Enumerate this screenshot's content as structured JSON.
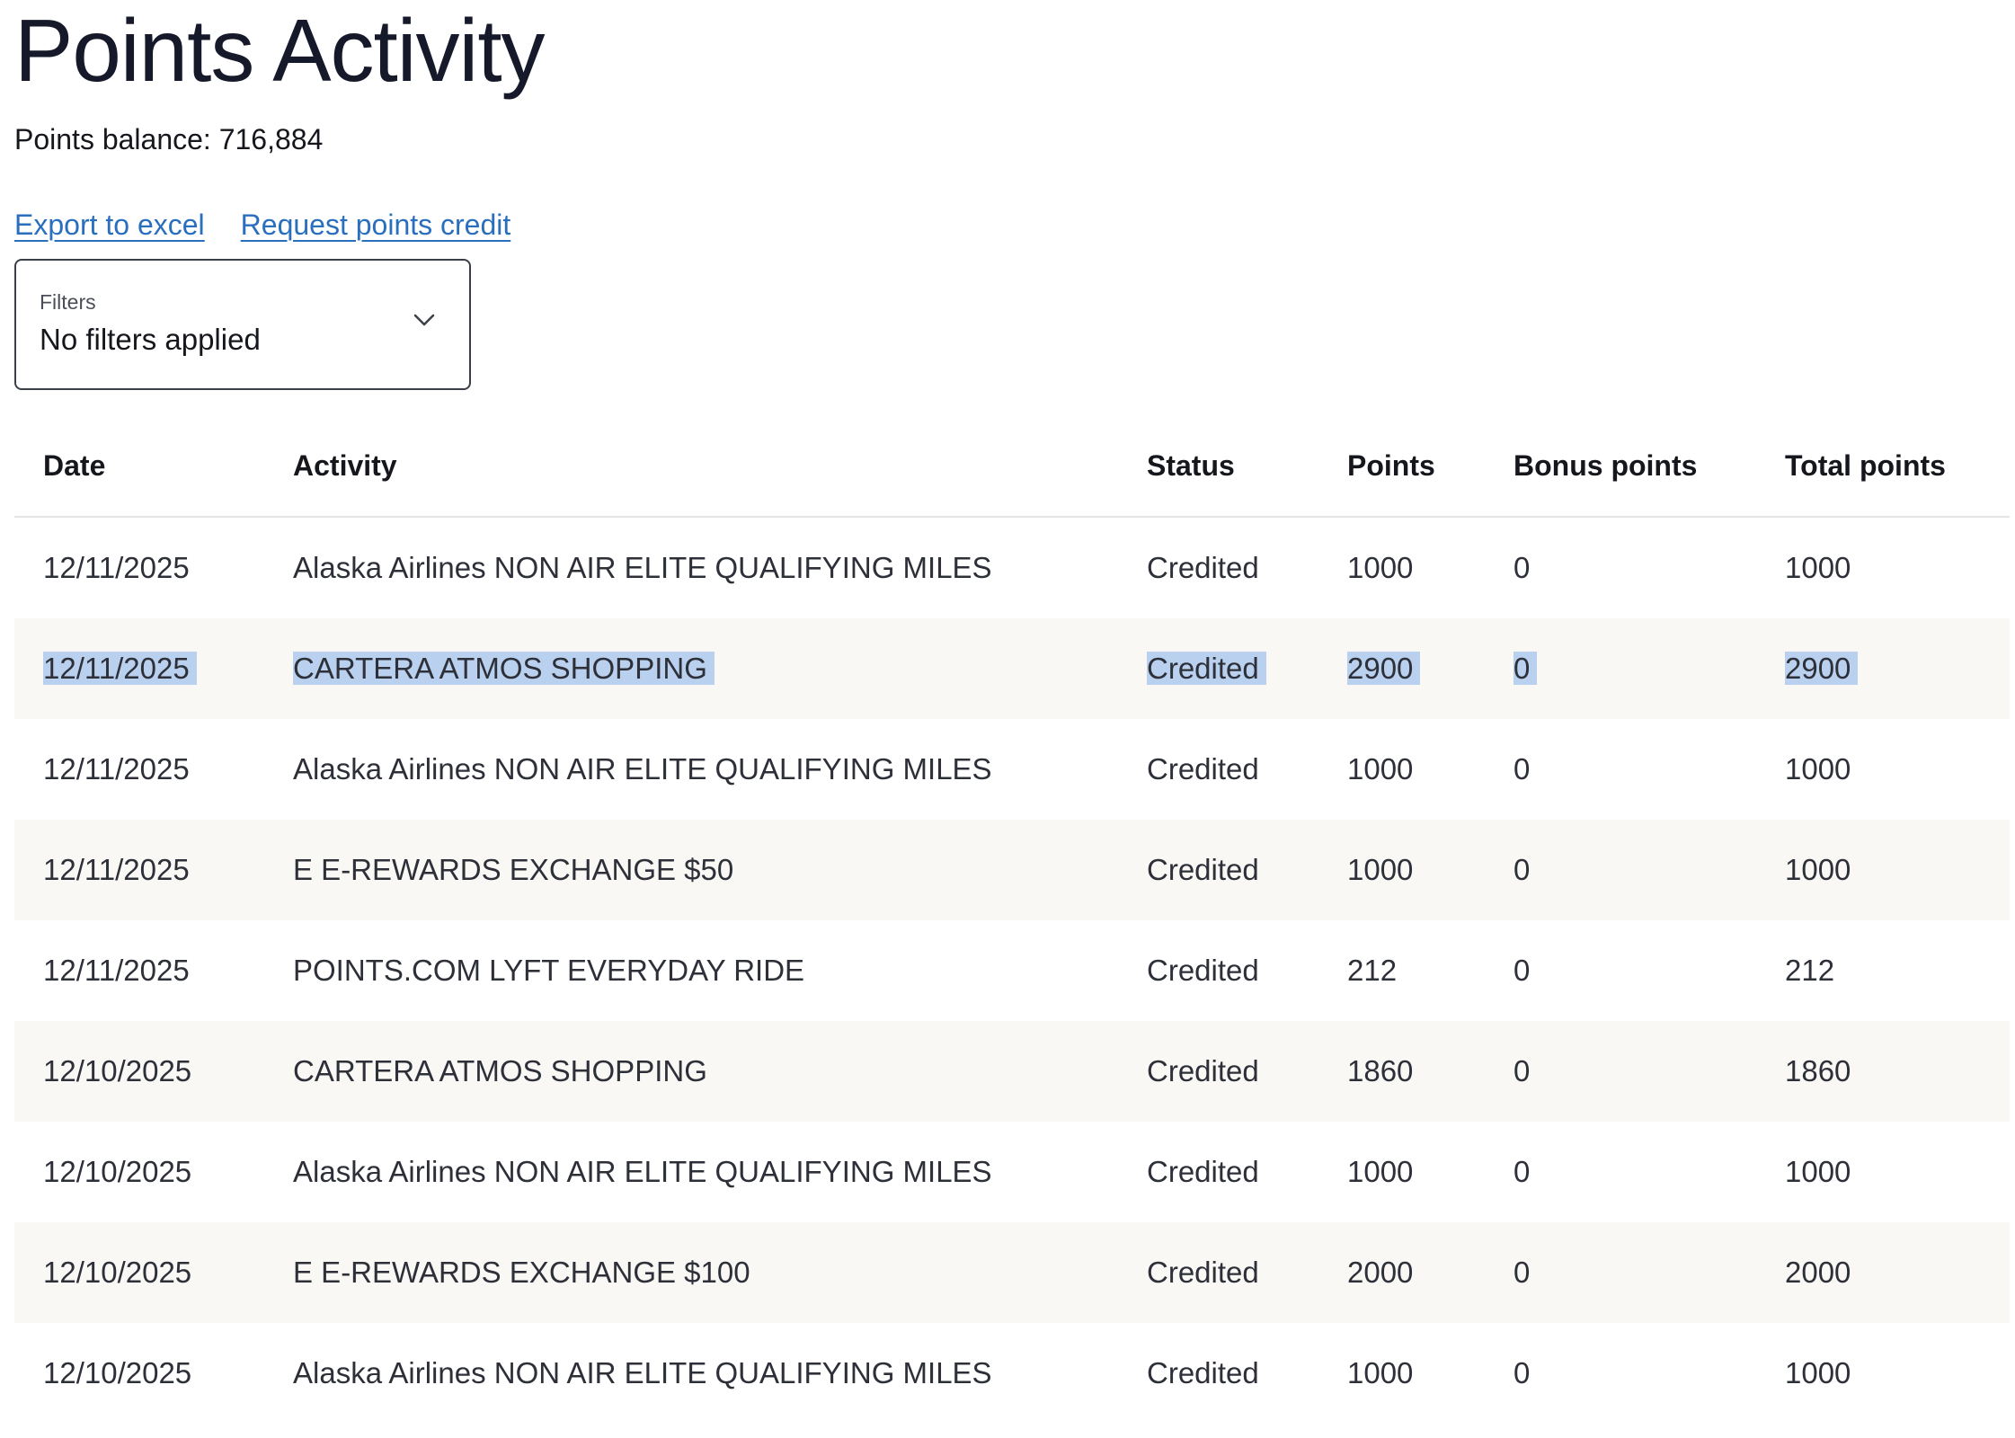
{
  "page": {
    "title": "Points Activity",
    "balance_label": "Points balance: 716,884"
  },
  "links": {
    "export": "Export to excel",
    "request": "Request points credit"
  },
  "filters": {
    "label": "Filters",
    "value": "No filters applied",
    "icon": "chevron-down-icon"
  },
  "table": {
    "headers": {
      "date": "Date",
      "activity": "Activity",
      "status": "Status",
      "points": "Points",
      "bonus": "Bonus points",
      "total": "Total points"
    },
    "rows": [
      {
        "date": "12/11/2025",
        "activity": "Alaska Airlines NON AIR ELITE QUALIFYING MILES",
        "status": "Credited",
        "points": "1000",
        "bonus": "0",
        "total": "1000"
      },
      {
        "date": "12/11/2025",
        "activity": "CARTERA ATMOS SHOPPING",
        "status": "Credited",
        "points": "2900",
        "bonus": "0",
        "total": "2900"
      },
      {
        "date": "12/11/2025",
        "activity": "Alaska Airlines NON AIR ELITE QUALIFYING MILES",
        "status": "Credited",
        "points": "1000",
        "bonus": "0",
        "total": "1000"
      },
      {
        "date": "12/11/2025",
        "activity": "E E-REWARDS EXCHANGE $50",
        "status": "Credited",
        "points": "1000",
        "bonus": "0",
        "total": "1000"
      },
      {
        "date": "12/11/2025",
        "activity": "POINTS.COM LYFT EVERYDAY RIDE",
        "status": "Credited",
        "points": "212",
        "bonus": "0",
        "total": "212"
      },
      {
        "date": "12/10/2025",
        "activity": "CARTERA ATMOS SHOPPING",
        "status": "Credited",
        "points": "1860",
        "bonus": "0",
        "total": "1860"
      },
      {
        "date": "12/10/2025",
        "activity": "Alaska Airlines NON AIR ELITE QUALIFYING MILES",
        "status": "Credited",
        "points": "1000",
        "bonus": "0",
        "total": "1000"
      },
      {
        "date": "12/10/2025",
        "activity": "E E-REWARDS EXCHANGE $100",
        "status": "Credited",
        "points": "2000",
        "bonus": "0",
        "total": "2000"
      },
      {
        "date": "12/10/2025",
        "activity": "Alaska Airlines NON AIR ELITE QUALIFYING MILES",
        "status": "Credited",
        "points": "1000",
        "bonus": "0",
        "total": "1000"
      }
    ]
  },
  "colors": {
    "link": "#2a6fbd",
    "selection": "#b9d0ef",
    "alt_row": "#f9f8f5"
  }
}
